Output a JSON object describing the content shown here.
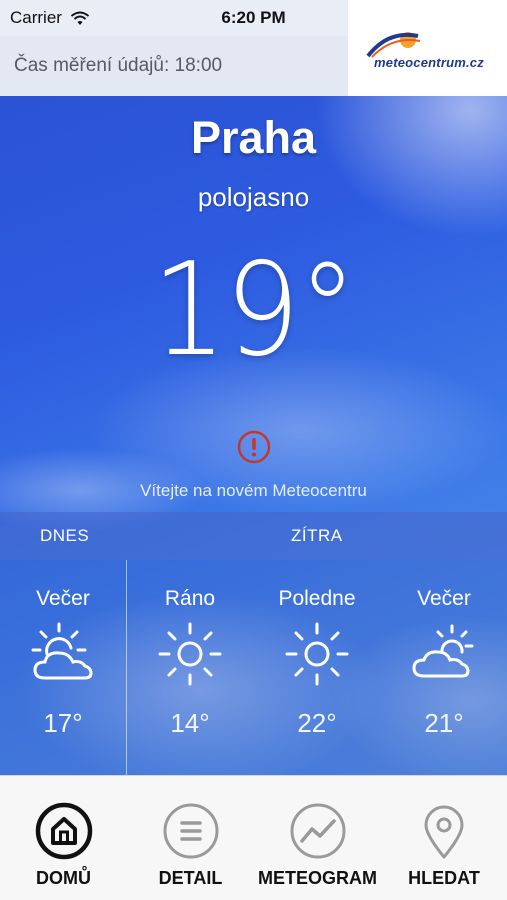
{
  "status_bar": {
    "carrier": "Carrier",
    "time": "6:20 PM",
    "battery_level": 1.0
  },
  "header": {
    "measure_time": "Čas měření údajů: 18:00",
    "logo": "meteocentrum.cz"
  },
  "current": {
    "city": "Praha",
    "condition": "polojasno",
    "temperature": "19°",
    "welcome": "Vítejte na novém Meteocentru"
  },
  "days": {
    "today": "DNES",
    "tomorrow": "ZÍTRA"
  },
  "forecast": [
    {
      "label": "Večer",
      "icon": "sun-cloud-icon",
      "temp": "17°"
    },
    {
      "label": "Ráno",
      "icon": "sun-icon",
      "temp": "14°"
    },
    {
      "label": "Poledne",
      "icon": "sun-icon",
      "temp": "22°"
    },
    {
      "label": "Večer",
      "icon": "sun-cloud-icon",
      "temp": "21°"
    }
  ],
  "tabs": [
    {
      "label": "DOMŮ",
      "icon": "home-icon",
      "active": true
    },
    {
      "label": "DETAIL",
      "icon": "list-icon",
      "active": false
    },
    {
      "label": "METEOGRAM",
      "icon": "graph-icon",
      "active": false
    },
    {
      "label": "HLEDAT",
      "icon": "location-pin-icon",
      "active": false
    }
  ],
  "colors": {
    "sky_blue": "#2d5be0",
    "alert_red": "#c0392b",
    "tab_active": "#111111",
    "tab_inactive": "#9a9a9a"
  }
}
